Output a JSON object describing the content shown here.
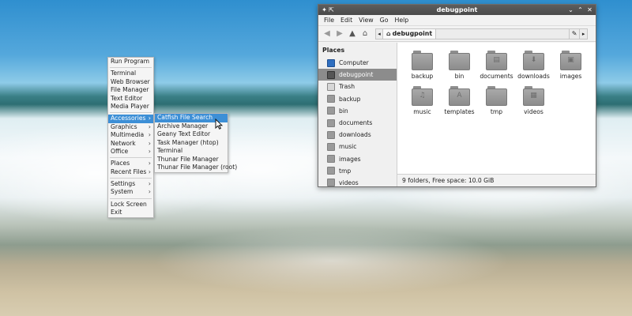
{
  "menu": {
    "items": [
      {
        "label": "Run Program"
      },
      {
        "sep": true
      },
      {
        "label": "Terminal"
      },
      {
        "label": "Web Browser"
      },
      {
        "label": "File Manager"
      },
      {
        "label": "Text Editor"
      },
      {
        "label": "Media Player"
      },
      {
        "sep": true
      },
      {
        "label": "Accessories",
        "submenu": true,
        "active": true
      },
      {
        "label": "Graphics",
        "submenu": true
      },
      {
        "label": "Multimedia",
        "submenu": true
      },
      {
        "label": "Network",
        "submenu": true
      },
      {
        "label": "Office",
        "submenu": true
      },
      {
        "sep": true
      },
      {
        "label": "Places",
        "submenu": true
      },
      {
        "label": "Recent Files",
        "submenu": true
      },
      {
        "sep": true
      },
      {
        "label": "Settings",
        "submenu": true
      },
      {
        "label": "System",
        "submenu": true
      },
      {
        "sep": true
      },
      {
        "label": "Lock Screen"
      },
      {
        "label": "Exit"
      }
    ],
    "submenu": [
      {
        "label": "Catfish File Search",
        "active": true
      },
      {
        "label": "Archive Manager"
      },
      {
        "label": "Geany Text Editor"
      },
      {
        "label": "Task Manager (htop)"
      },
      {
        "label": "Terminal"
      },
      {
        "label": "Thunar File Manager"
      },
      {
        "label": "Thunar File Manager (root)"
      }
    ]
  },
  "window": {
    "title": "debugpoint",
    "menubar": [
      "File",
      "Edit",
      "View",
      "Go",
      "Help"
    ],
    "path": "debugpoint",
    "sidebar": {
      "header": "Places",
      "items": [
        {
          "label": "Computer",
          "icon": "computer-icon"
        },
        {
          "label": "debugpoint",
          "icon": "home-icon",
          "active": true
        },
        {
          "label": "Trash",
          "icon": "trash-icon"
        },
        {
          "label": "backup",
          "icon": "folder-icon"
        },
        {
          "label": "bin",
          "icon": "folder-icon"
        },
        {
          "label": "documents",
          "icon": "folder-icon"
        },
        {
          "label": "downloads",
          "icon": "folder-icon"
        },
        {
          "label": "music",
          "icon": "folder-icon"
        },
        {
          "label": "images",
          "icon": "folder-icon"
        },
        {
          "label": "tmp",
          "icon": "folder-icon"
        },
        {
          "label": "videos",
          "icon": "folder-icon"
        }
      ]
    },
    "files": [
      {
        "label": "backup",
        "emblem": ""
      },
      {
        "label": "bin",
        "emblem": ""
      },
      {
        "label": "documents",
        "emblem": "▤"
      },
      {
        "label": "downloads",
        "emblem": "⬇"
      },
      {
        "label": "images",
        "emblem": "▣"
      },
      {
        "label": "music",
        "emblem": "♫"
      },
      {
        "label": "templates",
        "emblem": "A"
      },
      {
        "label": "tmp",
        "emblem": ""
      },
      {
        "label": "videos",
        "emblem": "▦"
      }
    ],
    "status": "9 folders, Free space: 10.0 GiB"
  },
  "colors": {
    "accent": "#3d8fd6",
    "titlebar": "#4f4f4f",
    "sidebar_active": "#8c8c8c"
  }
}
